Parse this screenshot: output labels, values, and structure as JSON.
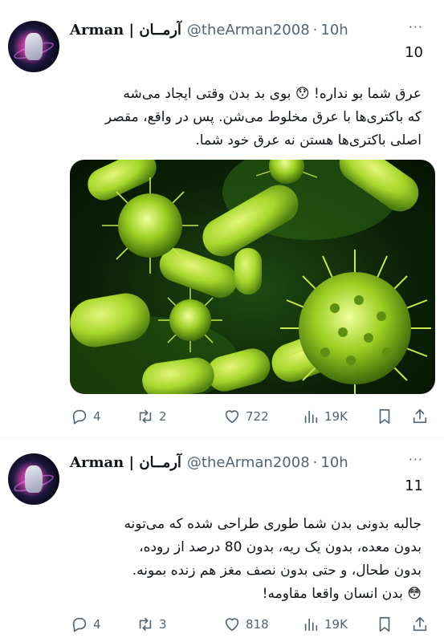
{
  "tweets": [
    {
      "display_name": "Arman | آرمــان",
      "handle": "@theArman2008",
      "separator": "·",
      "time": "10h",
      "more_icon": "···",
      "thread_number": "10",
      "text_lines": [
        "عرق شما بو نداره! 😯 بوی بد بدن وقتی ایجاد می‌شه",
        "که باکتری‌ها با عرق مخلوط می‌شن. پس در واقع، مقصر",
        "اصلی باکتری‌ها هستن نه عرق خود شما."
      ],
      "media_subject": "green bacteria microscopy illustration",
      "stats": {
        "replies": "4",
        "reposts": "2",
        "likes": "722",
        "views": "19K"
      }
    },
    {
      "display_name": "Arman | آرمــان",
      "handle": "@theArman2008",
      "separator": "·",
      "time": "10h",
      "more_icon": "···",
      "thread_number": "11",
      "text_lines": [
        "جالبه بدونی بدن شما طوری طراحی شده که می‌تونه",
        "بدون معده، بدون یک ریه، بدون 80 درصد از روده،",
        "بدون طحال، و حتی بدون نصف مغز هم زنده بمونه.",
        "😳 بدن انسان واقعا مقاومه!"
      ],
      "stats": {
        "replies": "4",
        "reposts": "3",
        "likes": "818",
        "views": "19K"
      }
    }
  ],
  "icons": {
    "reply": "reply-icon",
    "repost": "repost-icon",
    "like": "like-icon",
    "views": "views-icon",
    "bookmark": "bookmark-icon",
    "share": "share-icon"
  },
  "colors": {
    "text": "#0f1419",
    "secondary": "#536471",
    "bacteria": "#a6d62a",
    "background": "#ffffff"
  }
}
